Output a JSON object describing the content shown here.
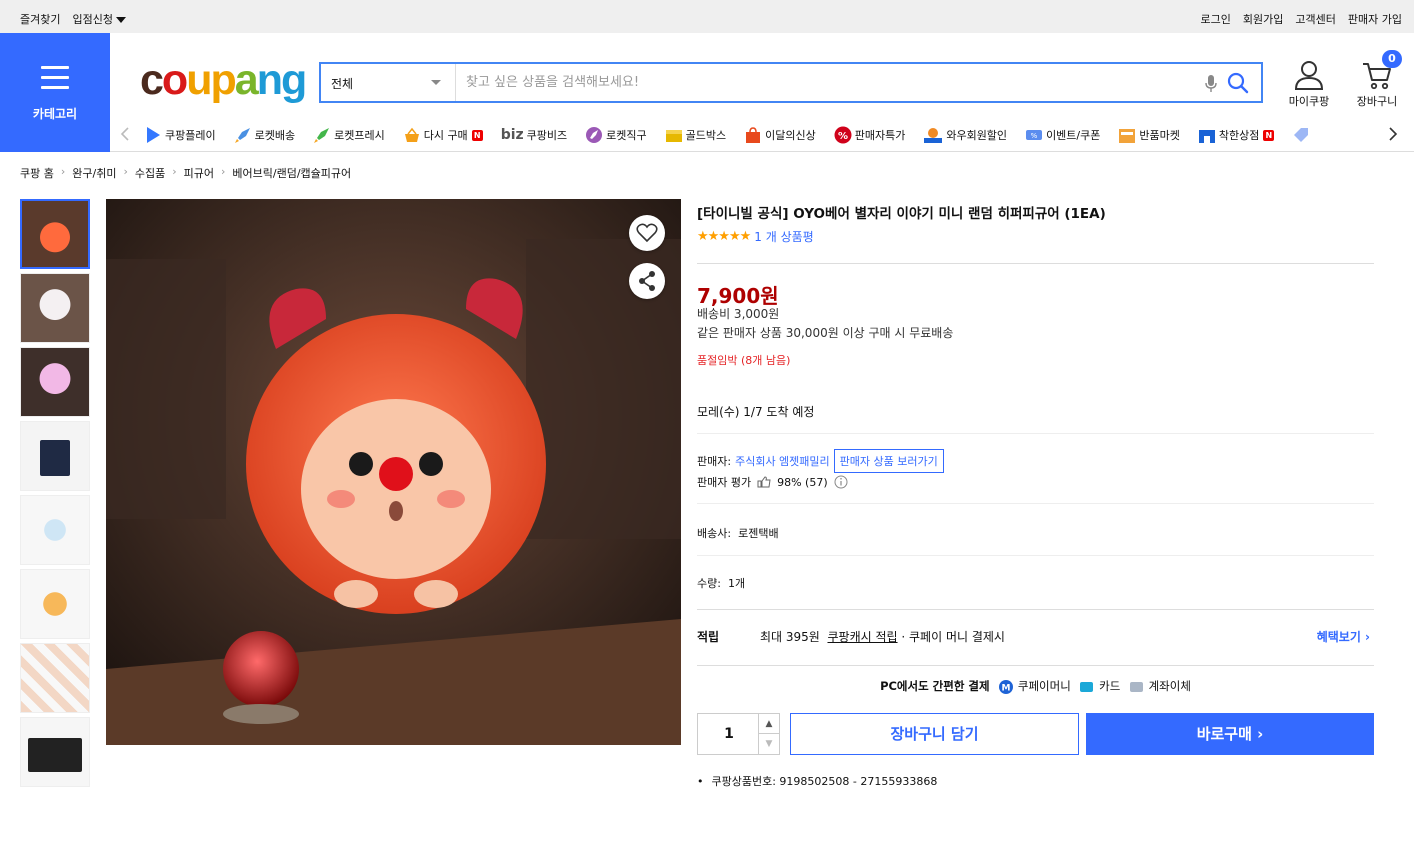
{
  "topbar": {
    "favorites": "즐겨찾기",
    "store_apply": "입점신청",
    "login": "로그인",
    "signup": "회원가입",
    "customer_center": "고객센터",
    "seller_signup": "판매자 가입"
  },
  "category": {
    "label": "카테고리"
  },
  "logo": {
    "c": "c",
    "o1": "o",
    "u": "u",
    "p": "p",
    "a": "a",
    "n": "n",
    "g": "g"
  },
  "search": {
    "category": "전체",
    "placeholder": "찾고 싶은 상품을 검색해보세요!"
  },
  "header": {
    "my_coupang": "마이쿠팡",
    "cart": "장바구니",
    "cart_count": "0"
  },
  "quickmenu": [
    {
      "label": "쿠팡플레이",
      "color": "#3478ff"
    },
    {
      "label": "로켓배송",
      "color": "#4a90e2"
    },
    {
      "label": "로켓프레시",
      "color": "#43b64a"
    },
    {
      "label": "다시 구매",
      "color": "#f4a019"
    },
    {
      "label": "쿠팡비즈",
      "color": "#555555"
    },
    {
      "label": "로켓직구",
      "color": "#9b59b6"
    },
    {
      "label": "골드박스",
      "color": "#e6b800"
    },
    {
      "label": "이달의신상",
      "color": "#e8491d"
    },
    {
      "label": "판매자특가",
      "color": "#d0021b"
    },
    {
      "label": "와우회원할인",
      "color": "#f08a24"
    },
    {
      "label": "이벤트/쿠폰",
      "color": "#5b8def"
    },
    {
      "label": "반품마켓",
      "color": "#f2a33a"
    },
    {
      "label": "착한상점",
      "color": "#1a63d6"
    }
  ],
  "quickmenu_extra": {
    "biz": "biz",
    "n": "N"
  },
  "breadcrumb": [
    "쿠팡 홈",
    "완구/취미",
    "수집품",
    "피규어",
    "베어브릭/랜덤/캡슐피규어"
  ],
  "product": {
    "title": "[타이니빌 공식] OYO베어 별자리 이야기 미니 랜덤 히퍼피규어 (1EA)",
    "stars": "★★★★★",
    "review_count": "1 개 상품평",
    "price": "7,900원",
    "shipping_fee": "배송비 3,000원",
    "free_shipping": "같은 판매자 상품 30,000원 이상 구매 시 무료배송",
    "stock_warning": "품절임박 (8개 남음)",
    "arrival": "모레(수) 1/7 도착 예정",
    "seller_label": "판매자:",
    "seller_name": "주식회사 엠젯패밀리",
    "seller_button": "판매자 상품 보러가기",
    "seller_rating_label": "판매자 평가",
    "seller_rating": "98% (57)",
    "carrier_label": "배송사:",
    "carrier": "로젠택배",
    "quantity_label": "수량:",
    "quantity_value": "1개",
    "reward_label": "적립",
    "reward_amount": "최대 395원",
    "reward_cash": "쿠팡캐시 적립",
    "reward_note": "· 쿠페이 머니 결제시",
    "reward_more": "혜택보기 ›",
    "pay_title": "PC에서도 간편한 결제",
    "pay_money": "쿠페이머니",
    "pay_card": "카드",
    "pay_transfer": "계좌이체",
    "qty": "1",
    "add_to_cart": "장바구니 담기",
    "buy_now": "바로구매 ›",
    "product_id": "쿠팡상품번호: 9198502508 - 27155933868"
  },
  "colors": {
    "accent": "#346aff",
    "price": "#ae0000",
    "warning": "#e52528"
  }
}
